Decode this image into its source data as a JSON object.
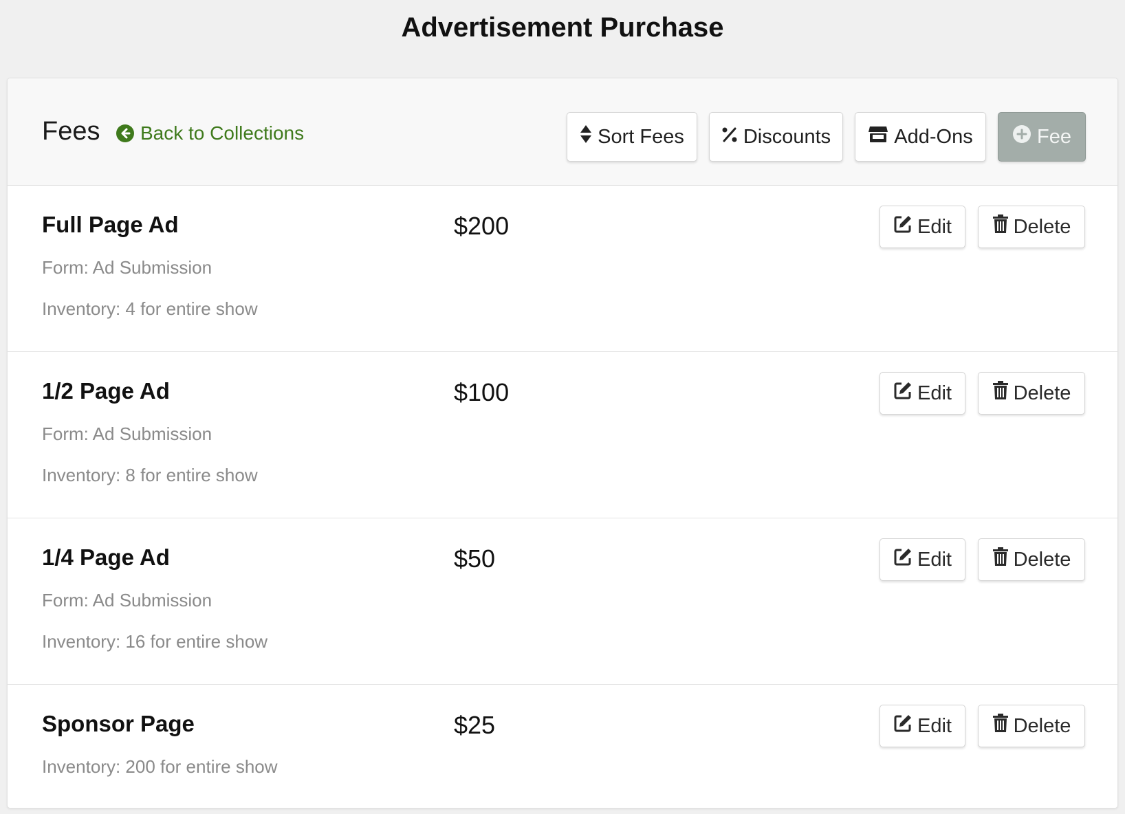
{
  "page": {
    "title": "Advertisement Purchase"
  },
  "header": {
    "title": "Fees",
    "back_link": "Back to Collections",
    "buttons": {
      "sort": "Sort Fees",
      "discounts": "Discounts",
      "addons": "Add-Ons",
      "fee": "Fee"
    }
  },
  "fees": [
    {
      "name": "Full Page Ad",
      "price": "$200",
      "form": "Form: Ad Submission",
      "inventory": "Inventory: 4 for entire show"
    },
    {
      "name": "1/2 Page Ad",
      "price": "$100",
      "form": "Form: Ad Submission",
      "inventory": "Inventory: 8 for entire show"
    },
    {
      "name": "1/4 Page Ad",
      "price": "$50",
      "form": "Form: Ad Submission",
      "inventory": "Inventory: 16 for entire show"
    },
    {
      "name": "Sponsor Page",
      "price": "$25",
      "inventory": "Inventory: 200 for entire show"
    }
  ],
  "row_actions": {
    "edit": "Edit",
    "delete": "Delete"
  },
  "icons": {
    "back": "arrow-circle-left-icon",
    "sort": "sort-icon",
    "discounts": "percent-icon",
    "addons": "store-icon",
    "fee": "plus-circle-icon",
    "edit": "edit-icon",
    "delete": "trash-icon"
  },
  "colors": {
    "link": "#3f7a1c",
    "disabled_button": "#a3ada9",
    "muted_text": "#8a8a8a"
  }
}
